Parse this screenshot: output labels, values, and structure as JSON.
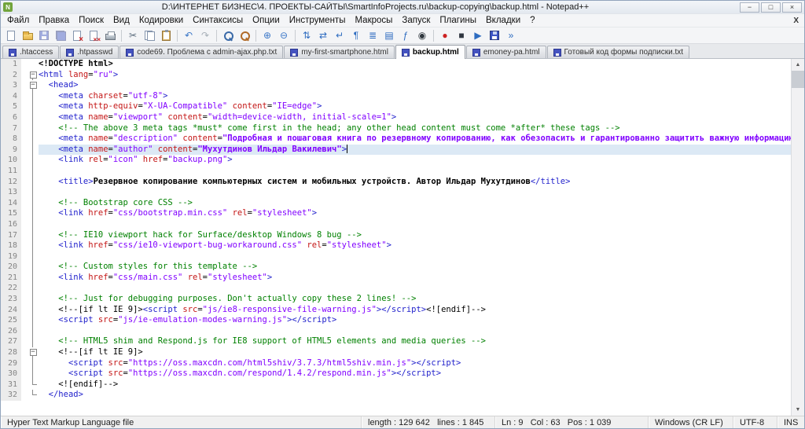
{
  "colors": {
    "tag": "#2222CC",
    "attribute": "#C41616",
    "value": "#8000FF",
    "comment": "#008000",
    "text": "#000000",
    "current_line": "#DCE9F5"
  },
  "window": {
    "title": "D:\\ИНТЕРНЕТ БИЗНЕС\\4. ПРОЕКТЫ-САЙТЫ\\SmartInfoProjects.ru\\backup-copying\\backup.html - Notepad++",
    "logo_letter": "N",
    "controls": [
      {
        "name": "minimize-button",
        "glyph": "−"
      },
      {
        "name": "maximize-button",
        "glyph": "□"
      },
      {
        "name": "close-button",
        "glyph": "×"
      }
    ]
  },
  "menu_bar": {
    "items": [
      "Файл",
      "Правка",
      "Поиск",
      "Вид",
      "Кодировки",
      "Синтаксисы",
      "Опции",
      "Инструменты",
      "Макросы",
      "Запуск",
      "Плагины",
      "Вкладки",
      "?"
    ],
    "close_x": "X"
  },
  "toolbar": {
    "items": [
      {
        "name": "new-file-icon",
        "kind": "page"
      },
      {
        "name": "open-folder-icon",
        "kind": "folder"
      },
      {
        "name": "save-icon",
        "kind": "floppy",
        "dim": true
      },
      {
        "name": "save-all-icon",
        "kind": "floppy2",
        "dim": true
      },
      {
        "name": "close-file-icon",
        "kind": "pagex"
      },
      {
        "name": "close-all-icon",
        "kind": "pagexx"
      },
      {
        "name": "print-icon",
        "kind": "printer"
      },
      {
        "sep": true
      },
      {
        "name": "cut-icon",
        "glyph": "✂",
        "color": "#5a6b7c"
      },
      {
        "name": "copy-icon",
        "kind": "pages"
      },
      {
        "name": "paste-icon",
        "kind": "clipboard"
      },
      {
        "sep": true
      },
      {
        "name": "undo-icon",
        "glyph": "↶",
        "color": "#3c78c8"
      },
      {
        "name": "redo-icon",
        "glyph": "↷",
        "color": "#a8b0b8"
      },
      {
        "sep": true
      },
      {
        "name": "find-icon",
        "kind": "mag"
      },
      {
        "name": "replace-icon",
        "kind": "magr"
      },
      {
        "sep": true
      },
      {
        "name": "zoom-in-icon",
        "glyph": "⊕",
        "color": "#3c78c8"
      },
      {
        "name": "zoom-out-icon",
        "glyph": "⊖",
        "color": "#3c78c8"
      },
      {
        "sep": true
      },
      {
        "name": "sync-vertical-scroll-icon",
        "glyph": "⇅",
        "color": "#2e6cc0"
      },
      {
        "name": "sync-horizontal-scroll-icon",
        "glyph": "⇄",
        "color": "#2e6cc0"
      },
      {
        "name": "word-wrap-icon",
        "glyph": "↵",
        "color": "#2e6cc0"
      },
      {
        "name": "show-all-characters-icon",
        "glyph": "¶",
        "color": "#2e6cc0"
      },
      {
        "name": "indent-guide-icon",
        "glyph": "≣",
        "color": "#2e6cc0"
      },
      {
        "name": "doc-map-icon",
        "glyph": "▤",
        "color": "#2e6cc0"
      },
      {
        "name": "function-list-icon",
        "glyph": "ƒ",
        "color": "#2e6cc0"
      },
      {
        "name": "monitoring-icon",
        "glyph": "◉",
        "color": "#30383f"
      },
      {
        "sep": true
      },
      {
        "name": "start-record-macro-icon",
        "glyph": "●",
        "color": "#cc2222"
      },
      {
        "name": "stop-record-macro-icon",
        "glyph": "■",
        "color": "#2f3640"
      },
      {
        "name": "playback-macro-icon",
        "glyph": "▶",
        "color": "#2e6cc0"
      },
      {
        "name": "save-macro-icon",
        "kind": "floppy"
      },
      {
        "name": "run-macro-multiple-icon",
        "glyph": "»",
        "color": "#2e6cc0"
      }
    ]
  },
  "tab_bar": {
    "tabs": [
      {
        "label": ".htaccess",
        "active": false
      },
      {
        "label": ".htpasswd",
        "active": false
      },
      {
        "label": "code69. Проблема с admin-ajax.php.txt",
        "active": false
      },
      {
        "label": "my-first-smartphone.html",
        "active": false
      },
      {
        "label": "backup.html",
        "active": true
      },
      {
        "label": "emoney-pa.html",
        "active": false
      },
      {
        "label": "Готовый код формы подписки.txt",
        "active": false
      }
    ]
  },
  "editor": {
    "current_line": 9,
    "lines": [
      {
        "n": 1,
        "f": "",
        "t": [
          [
            "dt",
            "<!DOCTYPE html>"
          ]
        ]
      },
      {
        "n": 2,
        "f": "box",
        "t": [
          [
            "t",
            "<html "
          ],
          [
            "a",
            "lang"
          ],
          [
            "d",
            "="
          ],
          [
            "v",
            "\"ru\""
          ],
          [
            "t",
            ">"
          ]
        ]
      },
      {
        "n": 3,
        "f": "box",
        "t": [
          [
            "d",
            "  "
          ],
          [
            "t",
            "<head>"
          ]
        ]
      },
      {
        "n": 4,
        "f": "v",
        "t": [
          [
            "d",
            "    "
          ],
          [
            "t",
            "<meta "
          ],
          [
            "a",
            "charset"
          ],
          [
            "d",
            "="
          ],
          [
            "v",
            "\"utf-8\""
          ],
          [
            "t",
            ">"
          ]
        ]
      },
      {
        "n": 5,
        "f": "v",
        "t": [
          [
            "d",
            "    "
          ],
          [
            "t",
            "<meta "
          ],
          [
            "a",
            "http-equiv"
          ],
          [
            "d",
            "="
          ],
          [
            "v",
            "\"X-UA-Compatible\""
          ],
          [
            "d",
            " "
          ],
          [
            "a",
            "content"
          ],
          [
            "d",
            "="
          ],
          [
            "v",
            "\"IE=edge\""
          ],
          [
            "t",
            ">"
          ]
        ]
      },
      {
        "n": 6,
        "f": "v",
        "t": [
          [
            "d",
            "    "
          ],
          [
            "t",
            "<meta "
          ],
          [
            "a",
            "name"
          ],
          [
            "d",
            "="
          ],
          [
            "v",
            "\"viewport\""
          ],
          [
            "d",
            " "
          ],
          [
            "a",
            "content"
          ],
          [
            "d",
            "="
          ],
          [
            "v",
            "\"width=device-width, initial-scale=1\""
          ],
          [
            "t",
            ">"
          ]
        ]
      },
      {
        "n": 7,
        "f": "v",
        "t": [
          [
            "d",
            "    "
          ],
          [
            "c",
            "<!-- The above 3 meta tags *must* come first in the head; any other head content must come *after* these tags -->"
          ]
        ]
      },
      {
        "n": 8,
        "f": "v",
        "t": [
          [
            "d",
            "    "
          ],
          [
            "t",
            "<meta "
          ],
          [
            "a",
            "name"
          ],
          [
            "d",
            "="
          ],
          [
            "v",
            "\"description\""
          ],
          [
            "d",
            " "
          ],
          [
            "a",
            "content"
          ],
          [
            "d",
            "="
          ],
          [
            "vb",
            "\"Подробная и пошаговая книга по резервному копированию, как обезопасить и гарантированно защитить важную информацию от внез"
          ]
        ]
      },
      {
        "n": 9,
        "f": "v",
        "t": [
          [
            "d",
            "    "
          ],
          [
            "t",
            "<meta "
          ],
          [
            "a",
            "name"
          ],
          [
            "d",
            "="
          ],
          [
            "v",
            "\"author\""
          ],
          [
            "d",
            " "
          ],
          [
            "a",
            "content"
          ],
          [
            "d",
            "="
          ],
          [
            "vb",
            "\"Мухутдинов Ильдар Вакилевич\""
          ],
          [
            "t",
            ">"
          ]
        ]
      },
      {
        "n": 10,
        "f": "v",
        "t": [
          [
            "d",
            "    "
          ],
          [
            "t",
            "<link "
          ],
          [
            "a",
            "rel"
          ],
          [
            "d",
            "="
          ],
          [
            "v",
            "\"icon\""
          ],
          [
            "d",
            " "
          ],
          [
            "a",
            "href"
          ],
          [
            "d",
            "="
          ],
          [
            "v",
            "\"backup.png\""
          ],
          [
            "t",
            ">"
          ]
        ]
      },
      {
        "n": 11,
        "f": "v",
        "t": []
      },
      {
        "n": 12,
        "f": "v",
        "t": [
          [
            "d",
            "    "
          ],
          [
            "t",
            "<title>"
          ],
          [
            "db",
            "Резервное копирование компьютерных систем и мобильных устройств. Автор Ильдар Мухутдинов"
          ],
          [
            "t",
            "</title>"
          ]
        ]
      },
      {
        "n": 13,
        "f": "v",
        "t": []
      },
      {
        "n": 14,
        "f": "v",
        "t": [
          [
            "d",
            "    "
          ],
          [
            "c",
            "<!-- Bootstrap core CSS -->"
          ]
        ]
      },
      {
        "n": 15,
        "f": "v",
        "t": [
          [
            "d",
            "    "
          ],
          [
            "t",
            "<link "
          ],
          [
            "a",
            "href"
          ],
          [
            "d",
            "="
          ],
          [
            "v",
            "\"css/bootstrap.min.css\""
          ],
          [
            "d",
            " "
          ],
          [
            "a",
            "rel"
          ],
          [
            "d",
            "="
          ],
          [
            "v",
            "\"stylesheet\""
          ],
          [
            "t",
            ">"
          ]
        ]
      },
      {
        "n": 16,
        "f": "v",
        "t": []
      },
      {
        "n": 17,
        "f": "v",
        "t": [
          [
            "d",
            "    "
          ],
          [
            "c",
            "<!-- IE10 viewport hack for Surface/desktop Windows 8 bug -->"
          ]
        ]
      },
      {
        "n": 18,
        "f": "v",
        "t": [
          [
            "d",
            "    "
          ],
          [
            "t",
            "<link "
          ],
          [
            "a",
            "href"
          ],
          [
            "d",
            "="
          ],
          [
            "v",
            "\"css/ie10-viewport-bug-workaround.css\""
          ],
          [
            "d",
            " "
          ],
          [
            "a",
            "rel"
          ],
          [
            "d",
            "="
          ],
          [
            "v",
            "\"stylesheet\""
          ],
          [
            "t",
            ">"
          ]
        ]
      },
      {
        "n": 19,
        "f": "v",
        "t": []
      },
      {
        "n": 20,
        "f": "v",
        "t": [
          [
            "d",
            "    "
          ],
          [
            "c",
            "<!-- Custom styles for this template -->"
          ]
        ]
      },
      {
        "n": 21,
        "f": "v",
        "t": [
          [
            "d",
            "    "
          ],
          [
            "t",
            "<link "
          ],
          [
            "a",
            "href"
          ],
          [
            "d",
            "="
          ],
          [
            "v",
            "\"css/main.css\""
          ],
          [
            "d",
            " "
          ],
          [
            "a",
            "rel"
          ],
          [
            "d",
            "="
          ],
          [
            "v",
            "\"stylesheet\""
          ],
          [
            "t",
            ">"
          ]
        ]
      },
      {
        "n": 22,
        "f": "v",
        "t": []
      },
      {
        "n": 23,
        "f": "v",
        "t": [
          [
            "d",
            "    "
          ],
          [
            "c",
            "<!-- Just for debugging purposes. Don't actually copy these 2 lines! -->"
          ]
        ]
      },
      {
        "n": 24,
        "f": "v",
        "t": [
          [
            "d",
            "    <!--[if lt IE 9]>"
          ],
          [
            "t",
            "<script "
          ],
          [
            "a",
            "src"
          ],
          [
            "d",
            "="
          ],
          [
            "v",
            "\"js/ie8-responsive-file-warning.js\""
          ],
          [
            "t",
            "></script>"
          ],
          [
            "d",
            "<![endif]-->"
          ]
        ]
      },
      {
        "n": 25,
        "f": "v",
        "t": [
          [
            "d",
            "    "
          ],
          [
            "t",
            "<script "
          ],
          [
            "a",
            "src"
          ],
          [
            "d",
            "="
          ],
          [
            "v",
            "\"js/ie-emulation-modes-warning.js\""
          ],
          [
            "t",
            "></script>"
          ]
        ]
      },
      {
        "n": 26,
        "f": "v",
        "t": []
      },
      {
        "n": 27,
        "f": "v",
        "t": [
          [
            "d",
            "    "
          ],
          [
            "c",
            "<!-- HTML5 shim and Respond.js for IE8 support of HTML5 elements and media queries -->"
          ]
        ]
      },
      {
        "n": 28,
        "f": "box",
        "t": [
          [
            "d",
            "    <!--[if lt IE 9]>"
          ]
        ]
      },
      {
        "n": 29,
        "f": "v",
        "t": [
          [
            "d",
            "      "
          ],
          [
            "t",
            "<script "
          ],
          [
            "a",
            "src"
          ],
          [
            "d",
            "="
          ],
          [
            "v",
            "\"https://oss.maxcdn.com/html5shiv/3.7.3/html5shiv.min.js\""
          ],
          [
            "t",
            "></script>"
          ]
        ]
      },
      {
        "n": 30,
        "f": "v",
        "t": [
          [
            "d",
            "      "
          ],
          [
            "t",
            "<script "
          ],
          [
            "a",
            "src"
          ],
          [
            "d",
            "="
          ],
          [
            "v",
            "\"https://oss.maxcdn.com/respond/1.4.2/respond.min.js\""
          ],
          [
            "t",
            "></script>"
          ]
        ]
      },
      {
        "n": 31,
        "f": "end",
        "t": [
          [
            "d",
            "    <![endif]-->"
          ]
        ]
      },
      {
        "n": 32,
        "f": "end",
        "t": [
          [
            "d",
            "  "
          ],
          [
            "t",
            "</head>"
          ]
        ]
      }
    ]
  },
  "scrollbar": {
    "up": "▲",
    "down": "▼"
  },
  "status_bar": {
    "doc_type": "Hyper Text Markup Language file",
    "length_info": "length : 129 642   lines : 1 845",
    "cursor_info": "Ln : 9   Col : 63   Pos : 1 039",
    "eol_format": "Windows (CR LF)",
    "encoding": "UTF-8",
    "typing_mode": "INS"
  }
}
